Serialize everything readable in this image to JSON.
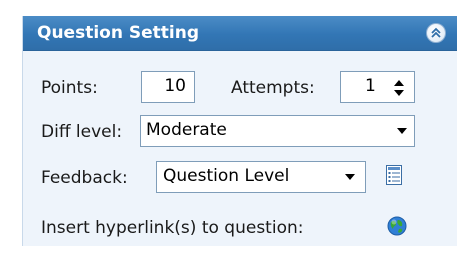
{
  "panel": {
    "title": "Question Setting",
    "collapse_icon": "double-chevron-up-icon"
  },
  "points": {
    "label": "Points:",
    "value": "10"
  },
  "attempts": {
    "label": "Attempts:",
    "value": "1"
  },
  "diff_level": {
    "label": "Diff level:",
    "value": "Moderate"
  },
  "feedback": {
    "label": "Feedback:",
    "value": "Question Level",
    "icon": "feedback-list-icon"
  },
  "hyperlink": {
    "label": "Insert hyperlink(s) to question:",
    "icon": "globe-icon"
  },
  "colors": {
    "header": "#3276b5",
    "panel_bg": "#eef4fb",
    "field_border": "#7f9db9"
  }
}
